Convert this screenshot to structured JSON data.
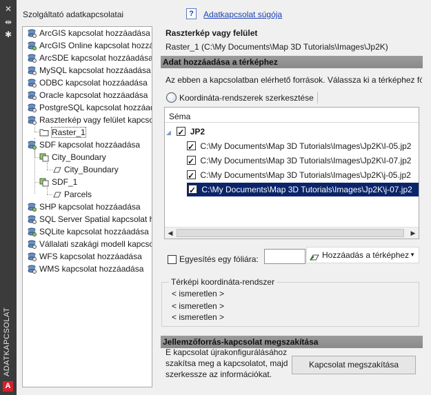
{
  "sidebar_title": "ADATKAPCSOLAT",
  "left_title": "Szolgáltató adatkapcsolatai",
  "help_link": "Adatkapcsolat súgója",
  "tree": [
    {
      "label": "ArcGIS kapcsolat hozzáadása",
      "icon": "connection-icon"
    },
    {
      "label": "ArcGIS Online kapcsolat hozzá",
      "icon": "connection-icon"
    },
    {
      "label": "ArcSDE kapcsolat hozzáadása",
      "icon": "connection-icon"
    },
    {
      "label": "MySQL kapcsolat hozzáadása",
      "icon": "connection-icon"
    },
    {
      "label": "ODBC kapcsolat hozzáadása",
      "icon": "connection-icon"
    },
    {
      "label": "Oracle kapcsolat hozzáadása",
      "icon": "connection-icon"
    },
    {
      "label": "PostgreSQL kapcsolat hozzáad",
      "icon": "connection-icon"
    },
    {
      "label": "Raszterkép vagy felület kapcsol",
      "icon": "connection-icon"
    },
    {
      "label": "Raster_1",
      "icon": "folder-icon"
    },
    {
      "label": "SDF kapcsolat hozzáadása",
      "icon": "connection-icon"
    },
    {
      "label": "City_Boundary",
      "icon": "layer-icon"
    },
    {
      "label": "City_Boundary",
      "icon": "feature-icon"
    },
    {
      "label": "SDF_1",
      "icon": "layer-icon"
    },
    {
      "label": "Parcels",
      "icon": "feature-icon"
    },
    {
      "label": "SHP kapcsolat hozzáadása",
      "icon": "connection-icon"
    },
    {
      "label": "SQL Server Spatial kapcsolat ho",
      "icon": "connection-icon"
    },
    {
      "label": "SQLite kapcsolat hozzáadása",
      "icon": "connection-icon"
    },
    {
      "label": "Vállalati szakági modell kapcsol",
      "icon": "connection-icon"
    },
    {
      "label": "WFS kapcsolat hozzáadása",
      "icon": "connection-icon"
    },
    {
      "label": "WMS kapcsolat hozzáadása",
      "icon": "connection-icon"
    }
  ],
  "right": {
    "title": "Raszterkép vagy felület",
    "subtitle": "Raster_1 (C:\\My Documents\\Map 3D Tutorials\\Images\\Jp2K)",
    "section_add": "Adat hozzáadása a térképhez",
    "description": "Az ebben a kapcsolatban elérhető források. Válassza ki a térképhez fól",
    "coord_button": "Koordináta-rendszerek szerkesztése",
    "grid_header": "Séma",
    "group_label": "JP2",
    "files": [
      {
        "path": "C:\\My Documents\\Map 3D Tutorials\\Images\\Jp2K\\I-05.jp2",
        "checked": true
      },
      {
        "path": "C:\\My Documents\\Map 3D Tutorials\\Images\\Jp2K\\I-07.jp2",
        "checked": true
      },
      {
        "path": "C:\\My Documents\\Map 3D Tutorials\\Images\\Jp2K\\j-05.jp2",
        "checked": true
      },
      {
        "path": "C:\\My Documents\\Map 3D Tutorials\\Images\\Jp2K\\j-07.jp2",
        "checked": true
      }
    ],
    "selected_file": "C:\\My Documents\\Map 3D Tutorials\\Images\\Jp2K\\j-07.jp2",
    "merge_label": "Egyesítés egy fóliára:",
    "merge_value": "",
    "add_button": "Hozzáadás a térképhez",
    "coord_group_title": "Térképi koordináta-rendszer",
    "coord_values": [
      "< ismeretlen >",
      "< ismeretlen >",
      "< ismeretlen >"
    ],
    "section_disconnect": "Jellemzőforrás-kapcsolat megszakítása",
    "disconnect_text": "E kapcsolat újrakonfigurálásához szakítsa meg a kapcsolatot, majd szerkessze az információkat.",
    "disconnect_button": "Kapcsolat megszakítása"
  },
  "colors": {
    "selection": "#0a246a",
    "section_bar": "#9b9b9b",
    "link": "#1a3fb3",
    "logo": "#d9202a"
  }
}
